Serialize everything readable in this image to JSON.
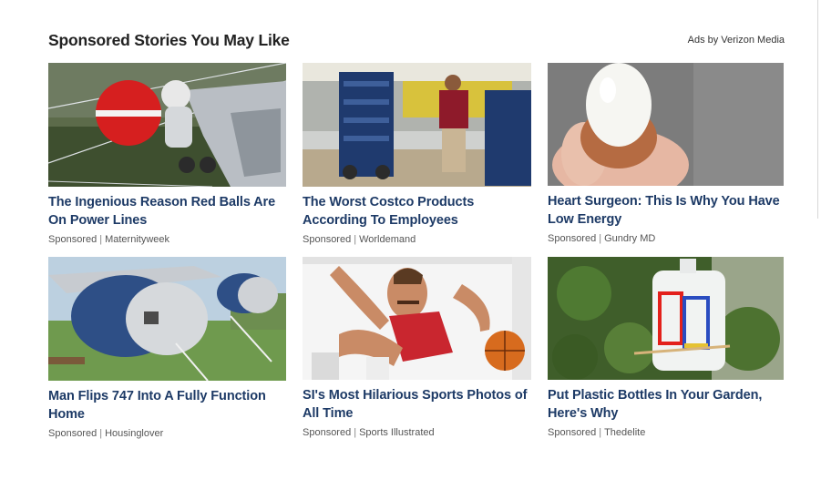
{
  "header": {
    "title": "Sponsored Stories You May Like",
    "attribution": "Ads by Verizon Media"
  },
  "cards": [
    {
      "title": "The Ingenious Reason Red Balls Are On Power Lines",
      "sponsored": "Sponsored",
      "source": "Maternityweek"
    },
    {
      "title": "The Worst Costco Products According To Employees",
      "sponsored": "Sponsored",
      "source": "Worldemand"
    },
    {
      "title": "Heart Surgeon: This Is Why You Have Low Energy",
      "sponsored": "Sponsored",
      "source": "Gundry MD"
    },
    {
      "title": "Man Flips 747 Into A Fully Function Home",
      "sponsored": "Sponsored",
      "source": "Housinglover"
    },
    {
      "title": "SI's Most Hilarious Sports Photos of All Time",
      "sponsored": "Sponsored",
      "source": "Sports Illustrated"
    },
    {
      "title": "Put Plastic Bottles In Your Garden, Here's Why",
      "sponsored": "Sponsored",
      "source": "Thedelite"
    }
  ]
}
